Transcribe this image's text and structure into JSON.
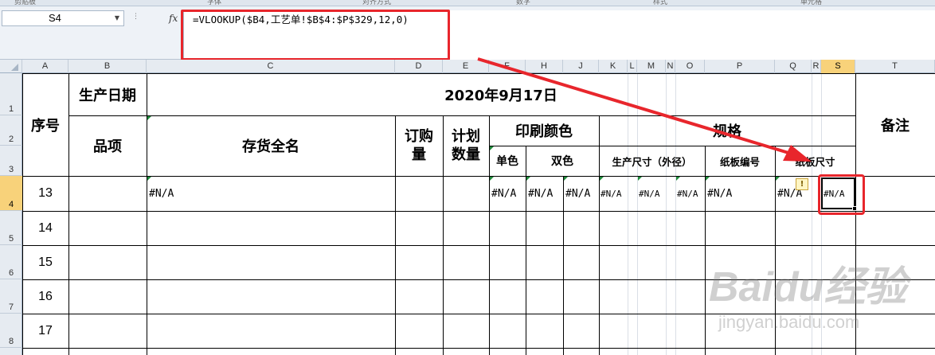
{
  "ribbon": {
    "groups": [
      "剪贴板",
      "字体",
      "对齐方式",
      "数字",
      "样式",
      "单元格"
    ]
  },
  "formula_bar": {
    "name_box": "S4",
    "fx_label": "fx",
    "formula": "=VLOOKUP($B4,工艺单!$B$4:$P$329,12,0)"
  },
  "columns": [
    "A",
    "B",
    "C",
    "D",
    "E",
    "F",
    "H",
    "J",
    "K",
    "L",
    "M",
    "N",
    "O",
    "P",
    "Q",
    "R",
    "S",
    "T"
  ],
  "rows": [
    "1",
    "2",
    "3",
    "4",
    "5",
    "6",
    "7",
    "8"
  ],
  "selected": {
    "column": "S",
    "row": "4"
  },
  "header": {
    "seq": "序号",
    "prod_date_label": "生产日期",
    "prod_date_value": "2020年9月17日",
    "item": "品项",
    "full_name": "存货全名",
    "order_qty": "订购量",
    "plan_qty": "计划数量",
    "print_color": "印刷颜色",
    "single_color": "单色",
    "double_color": "双色",
    "spec": "规格",
    "prod_size": "生产尺寸（外径）",
    "board_no": "纸板编号",
    "board_size": "纸板尺寸",
    "remark": "备注"
  },
  "data_rows": [
    {
      "seq": "13",
      "full_name": "#N/A",
      "f": "#N/A",
      "h": "#N/A",
      "j": "#N/A",
      "k": "#N/A",
      "m": "#N/A",
      "o": "#N/A",
      "p": "#N/A",
      "q": "#N/A",
      "s": "#N/A"
    },
    {
      "seq": "14"
    },
    {
      "seq": "15"
    },
    {
      "seq": "16"
    },
    {
      "seq": "17"
    }
  ],
  "watermark": {
    "logo": "Baidu经验",
    "url": "jingyan.baidu.com"
  },
  "colors": {
    "highlight": "#e8262c",
    "selected_header": "#f8d27a",
    "green_indicator": "#1f8a3a"
  }
}
